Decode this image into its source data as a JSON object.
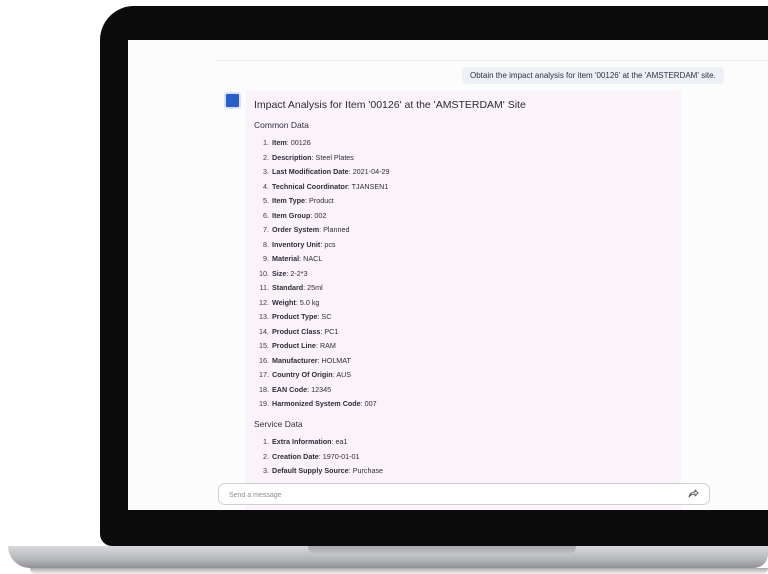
{
  "chat": {
    "user_message": "Obtain the impact analysis for item '00126' at the 'AMSTERDAM' site.",
    "answer": {
      "title": "Impact Analysis for Item '00126' at the 'AMSTERDAM' Site",
      "sections": [
        {
          "heading": "Common Data",
          "items": [
            {
              "num": "1.",
              "key": "Item",
              "value": "00126"
            },
            {
              "num": "2.",
              "key": "Description",
              "value": "Steel Plates"
            },
            {
              "num": "3.",
              "key": "Last Modification Date",
              "value": "2021-04-29"
            },
            {
              "num": "4.",
              "key": "Technical Coordinator",
              "value": "TJANSEN1"
            },
            {
              "num": "5.",
              "key": "Item Type",
              "value": "Product"
            },
            {
              "num": "6.",
              "key": "Item Group",
              "value": "002"
            },
            {
              "num": "7.",
              "key": "Order System",
              "value": "Planned"
            },
            {
              "num": "8.",
              "key": "Inventory Unit",
              "value": "pcs"
            },
            {
              "num": "9.",
              "key": "Material",
              "value": "NACL"
            },
            {
              "num": "10.",
              "key": "Size",
              "value": "2-2*3"
            },
            {
              "num": "11.",
              "key": "Standard",
              "value": "25ml"
            },
            {
              "num": "12.",
              "key": "Weight",
              "value": "5.0 kg"
            },
            {
              "num": "13.",
              "key": "Product Type",
              "value": "SC"
            },
            {
              "num": "14.",
              "key": "Product Class",
              "value": "PC1"
            },
            {
              "num": "15.",
              "key": "Product Line",
              "value": "RAM"
            },
            {
              "num": "16.",
              "key": "Manufacturer",
              "value": "HOLMAT"
            },
            {
              "num": "17.",
              "key": "Country Of Origin",
              "value": "AUS"
            },
            {
              "num": "18.",
              "key": "EAN Code",
              "value": "12345"
            },
            {
              "num": "19.",
              "key": "Harmonized System Code",
              "value": "007"
            }
          ]
        },
        {
          "heading": "Service Data",
          "items": [
            {
              "num": "1.",
              "key": "Extra Information",
              "value": "ea1"
            },
            {
              "num": "2.",
              "key": "Creation Date",
              "value": "1970-01-01"
            },
            {
              "num": "3.",
              "key": "Default Supply Source",
              "value": "Purchase"
            }
          ]
        }
      ]
    }
  },
  "composer": {
    "placeholder": "Send a message",
    "send_icon": "send-arrow-icon"
  },
  "colors": {
    "answer_background": "#fbf3fa",
    "user_bubble": "#eef0f8",
    "avatar": "#2b5ec9"
  }
}
